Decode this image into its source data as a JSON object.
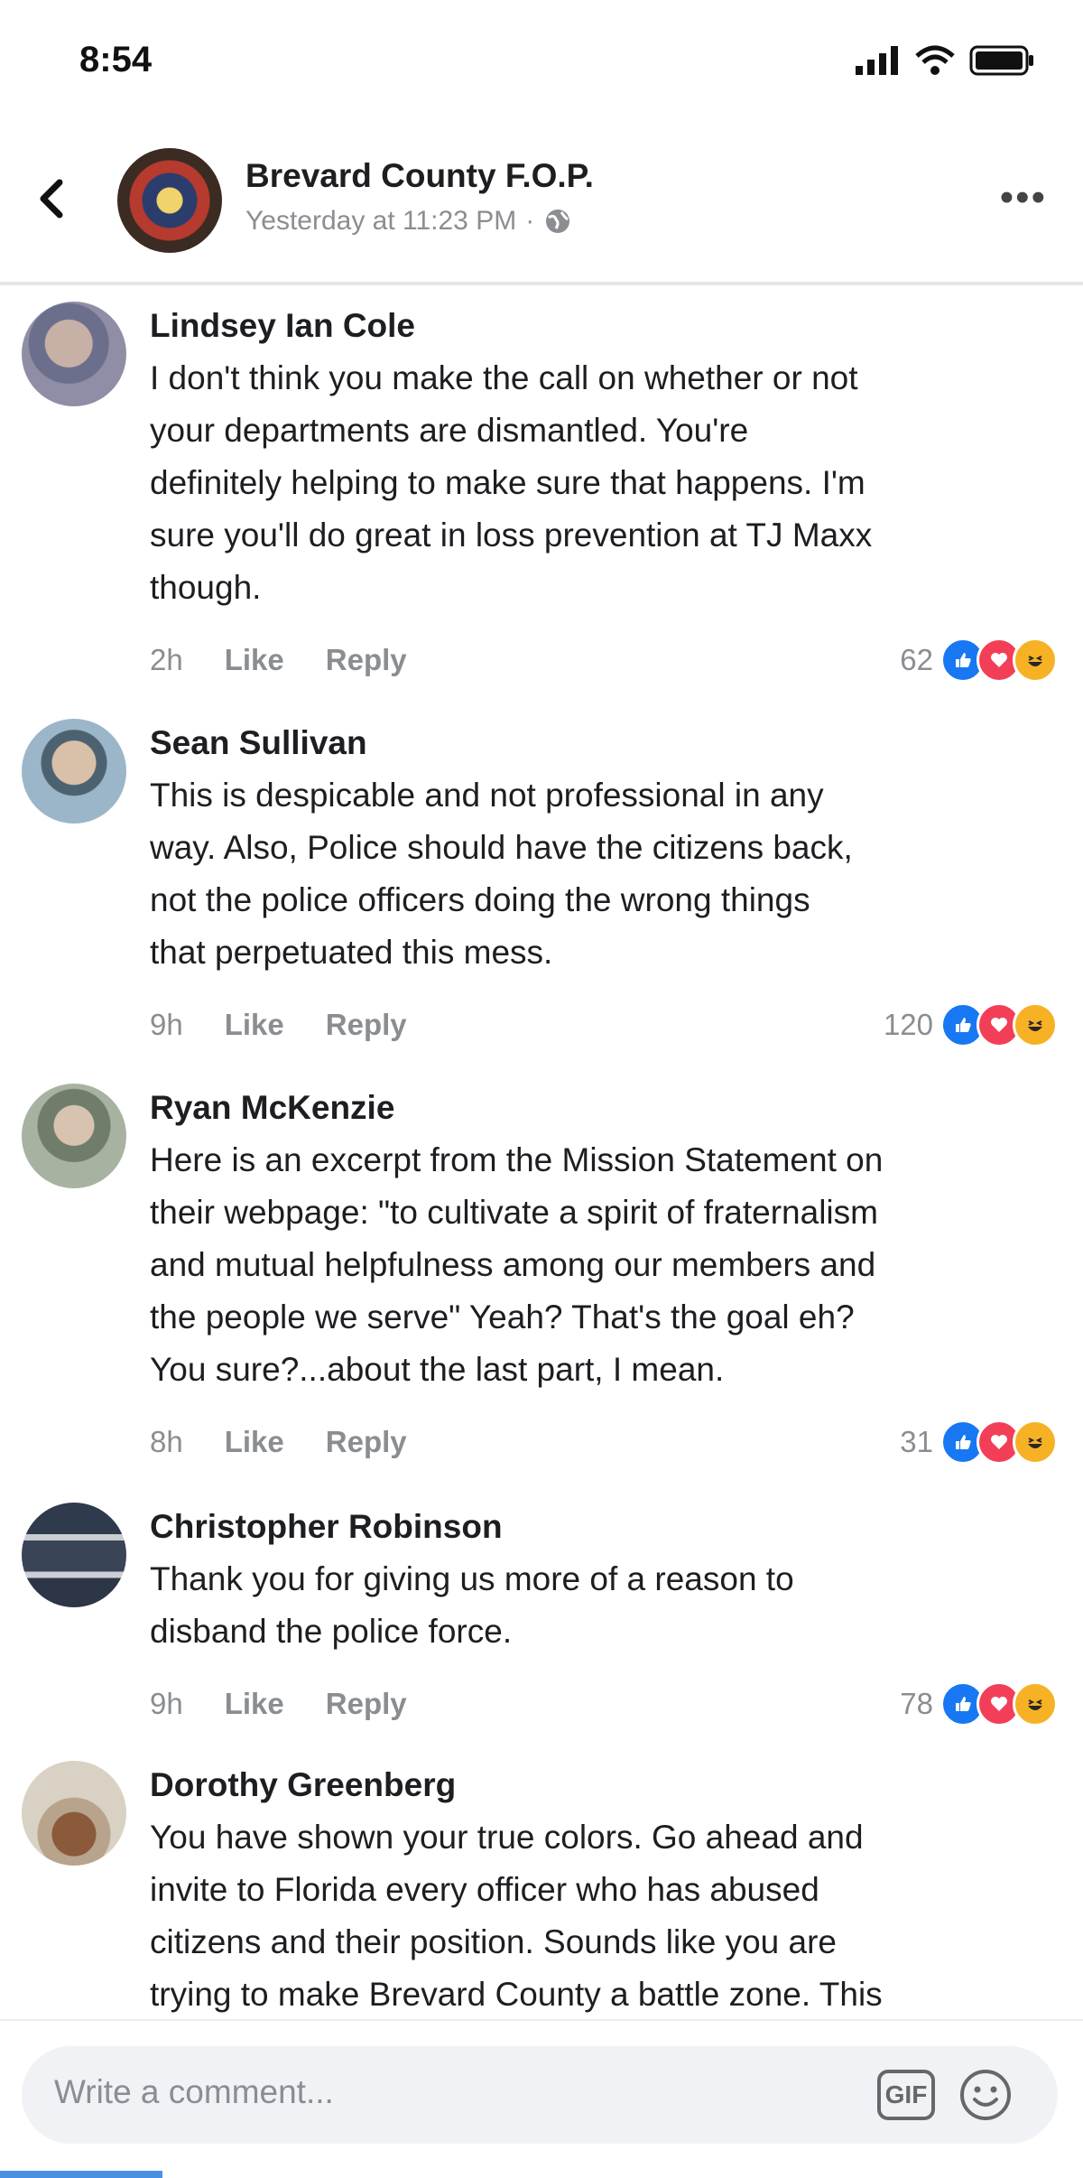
{
  "status_bar": {
    "time": "8:54",
    "icons": [
      "signal-icon",
      "wifi-icon",
      "battery-icon"
    ]
  },
  "post_header": {
    "page_name": "Brevard County F.O.P.",
    "timestamp": "Yesterday at 11:23 PM",
    "separator": "·",
    "audience_icon": "globe-icon",
    "more_label": "•••"
  },
  "comments": [
    {
      "author": "Lindsey Ian Cole",
      "text": "I don't think you make the call on whether or not\nyour departments are dismantled. You're\ndefinitely helping to make sure that happens. I'm\nsure you'll do great in loss prevention at TJ Maxx\nthough.",
      "time": "2h",
      "like_label": "Like",
      "reply_label": "Reply",
      "reaction_count": "62",
      "reactions": [
        "like",
        "love",
        "haha"
      ]
    },
    {
      "author": "Sean Sullivan",
      "text": "This is despicable and not professional in any\nway. Also, Police should have the citizens back,\nnot the police officers doing the wrong things\nthat perpetuated this mess.",
      "time": "9h",
      "like_label": "Like",
      "reply_label": "Reply",
      "reaction_count": "120",
      "reactions": [
        "like",
        "love",
        "haha"
      ]
    },
    {
      "author": "Ryan McKenzie",
      "text": "Here is an excerpt from the Mission Statement on\ntheir webpage: \"to cultivate a spirit of fraternalism\nand mutual helpfulness among our members and\nthe people we serve\"  Yeah?  That's the goal eh?\nYou sure?...about the last part, I mean.",
      "time": "8h",
      "like_label": "Like",
      "reply_label": "Reply",
      "reaction_count": "31",
      "reactions": [
        "like",
        "love",
        "haha"
      ]
    },
    {
      "author": "Christopher Robinson",
      "text": "Thank you for giving us more of a reason to\ndisband the police force.",
      "time": "9h",
      "like_label": "Like",
      "reply_label": "Reply",
      "reaction_count": "78",
      "reactions": [
        "like",
        "love",
        "haha"
      ]
    },
    {
      "author": "Dorothy Greenberg",
      "text": "You have shown your true colors.  Go ahead and\ninvite to Florida every officer who has abused\ncitizens and their position.  Sounds like you are\ntrying to make Brevard County a battle zone.  This",
      "time": "",
      "like_label": "",
      "reply_label": "",
      "reaction_count": "",
      "reactions": []
    }
  ],
  "composer": {
    "placeholder": "Write a comment...",
    "gif_label": "GIF",
    "emoji_icon": "emoji-icon"
  },
  "colors": {
    "like": "#1877f2",
    "love": "#f33e58",
    "haha": "#f7b125",
    "meta": "#8a8d91"
  }
}
